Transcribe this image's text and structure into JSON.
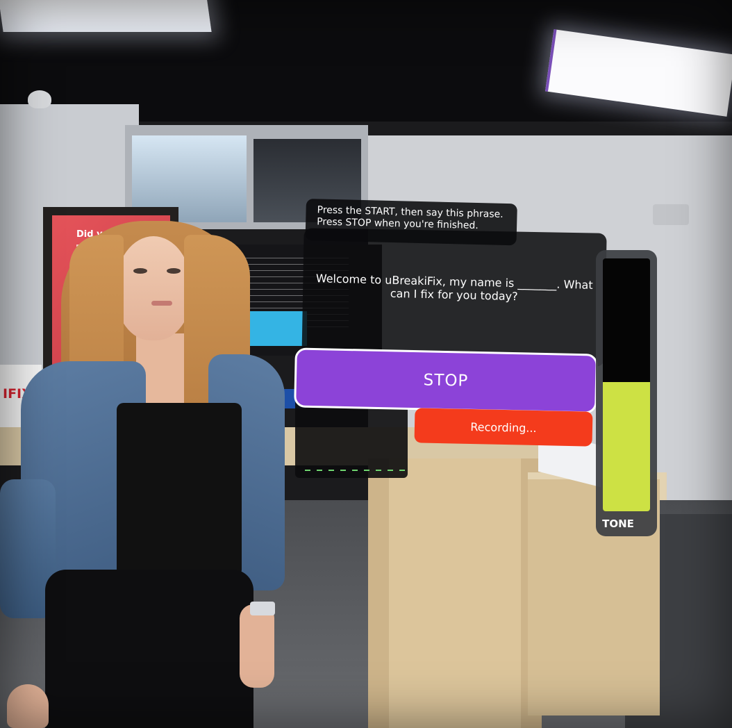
{
  "instruction": {
    "line1": "Press the START, then say this phrase.",
    "line2": "Press STOP when you're finished."
  },
  "phrase": {
    "text": "Welcome to uBreakiFix, my name is _______. What can I fix for you today?"
  },
  "controls": {
    "stop_label": "STOP",
    "recording_label": "Recording..."
  },
  "tone_meter": {
    "label": "TONE",
    "level": 0.51,
    "fill_color": "#cde144"
  },
  "environment": {
    "tv_text": "Did you k",
    "sign_text": "IFIX."
  },
  "colors": {
    "stop_button": "#8c43d8",
    "recording_badge": "#f43b1c"
  }
}
